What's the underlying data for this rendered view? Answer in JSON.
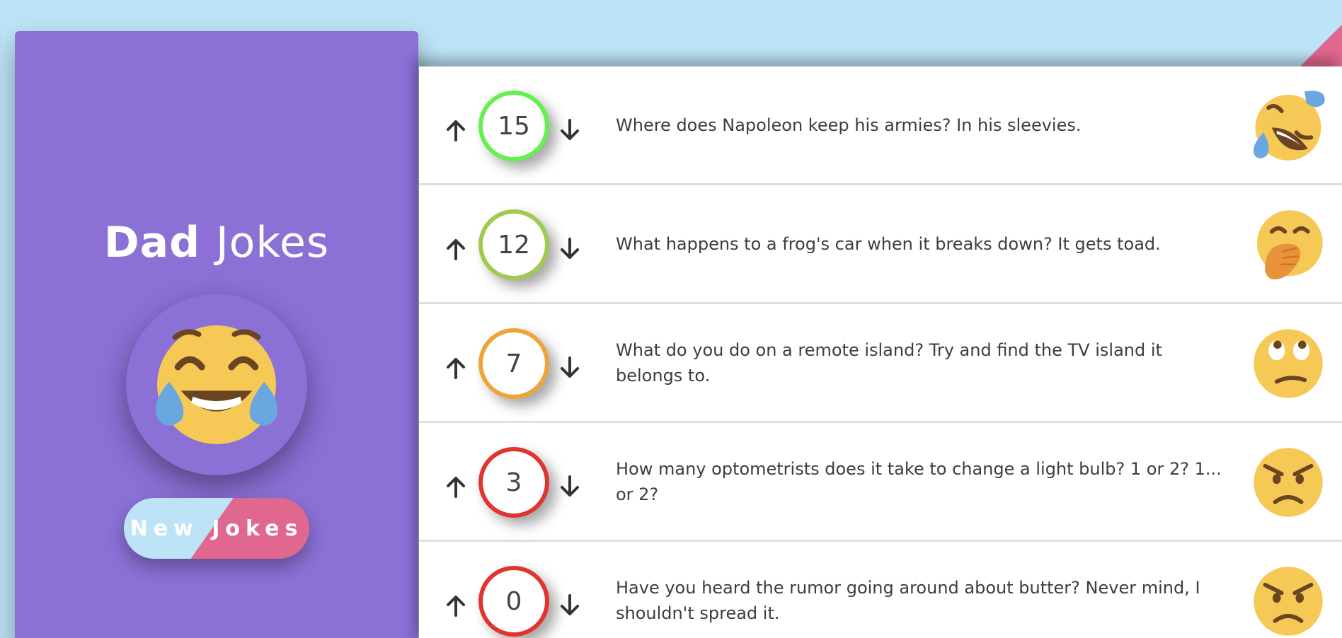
{
  "app": {
    "title_bold": "Dad",
    "title_light": "Jokes",
    "new_jokes_button": "New Jokes"
  },
  "colors": {
    "background": "#bde3f6",
    "accent_pink": "#e0678e",
    "sidebar": "#8b70d6"
  },
  "jokes": [
    {
      "score": "15",
      "text": "Where does Napoleon keep his armies? In his sleevies.",
      "border_color": "#65f04f",
      "emoji": "rolling-on-floor-laughing-icon"
    },
    {
      "score": "12",
      "text": "What happens to a frog's car when it breaks down? It gets toad.",
      "border_color": "#9ecb4e",
      "emoji": "hand-over-mouth-icon"
    },
    {
      "score": "7",
      "text": "What do you do on a remote island? Try and find the TV island it belongs to.",
      "border_color": "#efa43a",
      "emoji": "eye-roll-icon"
    },
    {
      "score": "3",
      "text": "How many optometrists does it take to change a light bulb? 1 or 2? 1... or 2?",
      "border_color": "#e1342f",
      "emoji": "angry-face-icon"
    },
    {
      "score": "0",
      "text": "Have you heard the rumor going around about butter? Never mind, I shouldn't spread it.",
      "border_color": "#e1342f",
      "emoji": "angry-face-icon"
    }
  ]
}
